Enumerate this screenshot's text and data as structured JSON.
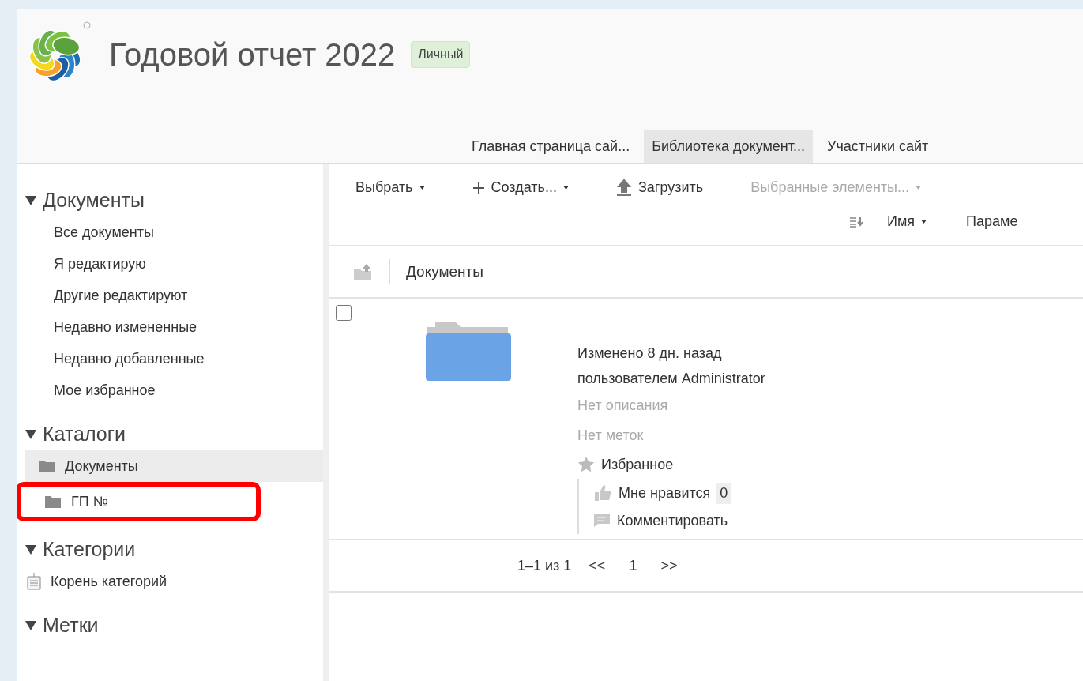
{
  "header": {
    "title": "Годовой отчет 2022",
    "badge": "Личный"
  },
  "nav_tabs": [
    {
      "label": "Главная страница сай...",
      "selected": false
    },
    {
      "label": "Библиотека документ...",
      "selected": true
    },
    {
      "label": "Участники сайт",
      "selected": false
    }
  ],
  "sidebar": {
    "sections": [
      {
        "title": "Документы",
        "expanded": true,
        "kind": "links",
        "items": [
          {
            "label": "Все документы"
          },
          {
            "label": "Я редактирую"
          },
          {
            "label": "Другие редактируют"
          },
          {
            "label": "Недавно измененные"
          },
          {
            "label": "Недавно добавленные"
          },
          {
            "label": "Мое избранное"
          }
        ]
      },
      {
        "title": "Каталоги",
        "expanded": true,
        "kind": "folders",
        "items": [
          {
            "label": "Документы",
            "selected": true,
            "highlighted": false,
            "children": [
              {
                "label": "ГП №",
                "selected": false,
                "highlighted": true
              }
            ]
          }
        ]
      },
      {
        "title": "Категории",
        "expanded": true,
        "kind": "categories",
        "items": [
          {
            "label": "Корень категорий"
          }
        ]
      },
      {
        "title": "Метки",
        "expanded": true
      }
    ]
  },
  "toolbar": {
    "buttons": [
      {
        "label": "Выбрать",
        "kind": "menu",
        "disabled": false
      },
      {
        "label": "Создать...",
        "kind": "create",
        "disabled": false
      },
      {
        "label": "Загрузить",
        "kind": "upload",
        "disabled": false
      },
      {
        "label": "Выбранные элементы...",
        "kind": "menu",
        "disabled": true
      }
    ],
    "sort": {
      "label": "Имя"
    },
    "options": {
      "label": "Параме"
    }
  },
  "breadcrumb": {
    "label": "Документы"
  },
  "documents": [
    {
      "checked": false,
      "modified": "Изменено 8 дн. назад",
      "modified_by": "пользователем Administrator",
      "description": "Нет описания",
      "tags": "Нет меток",
      "favorite": {
        "label": "Избранное",
        "on": false
      },
      "like": {
        "label": "Мне нравится",
        "count": "0"
      },
      "comment": "Комментировать"
    }
  ],
  "pagination": {
    "range": "1–1 из 1",
    "prev": "<<",
    "page": "1",
    "next": ">>"
  }
}
